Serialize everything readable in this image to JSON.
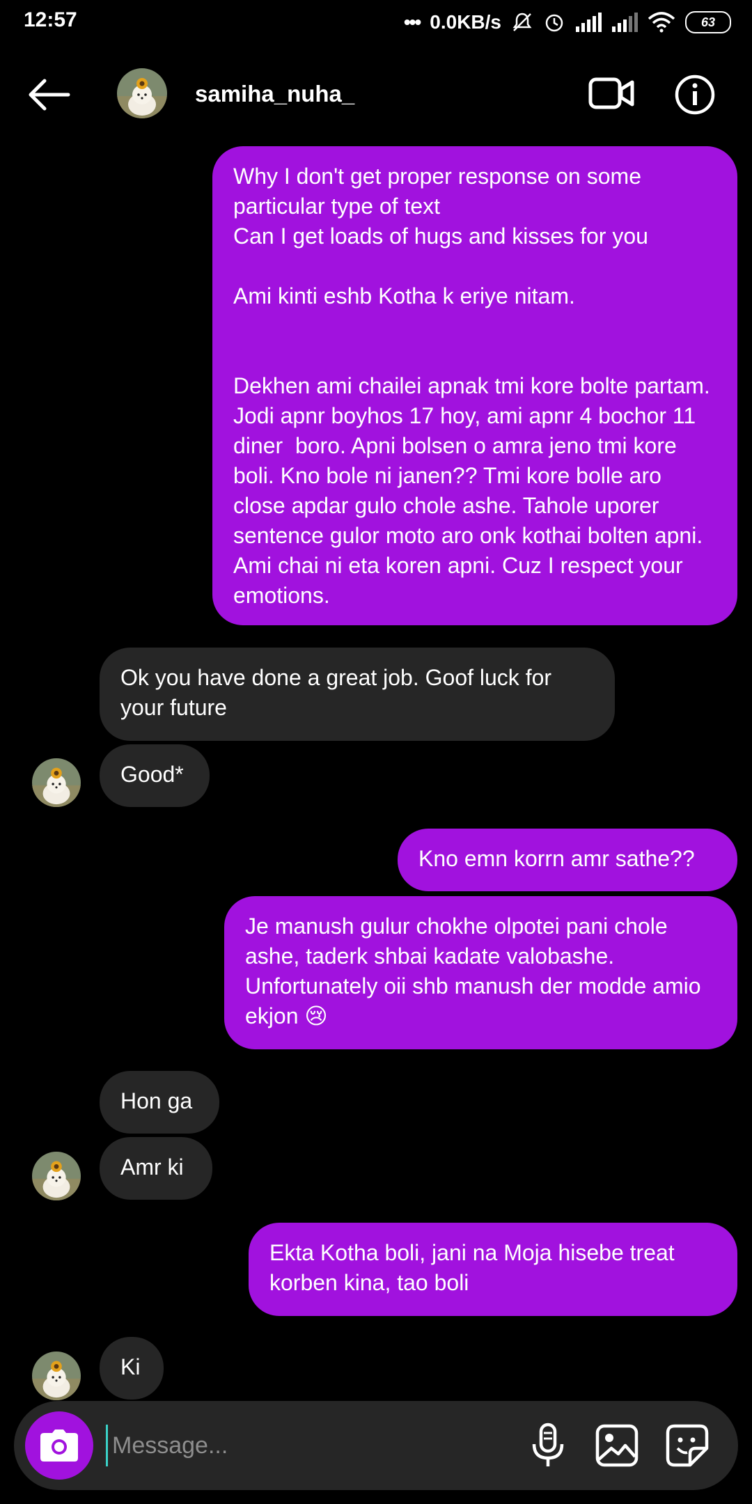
{
  "status_bar": {
    "time": "12:57",
    "net_speed": "0.0KB/s",
    "battery": "63"
  },
  "header": {
    "username": "samiha_nuha_"
  },
  "messages": [
    {
      "id": "m1",
      "type": "sent",
      "text": "Why I don't get proper response on some particular type of text\nCan I get loads of hugs and kisses for you\n\nAmi kinti eshb Kotha k eriye nitam.\n\n\nDekhen ami chailei apnak tmi kore bolte partam. Jodi apnr boyhos 17 hoy, ami apnr 4 bochor 11 diner  boro. Apni bolsen o amra jeno tmi kore boli. Kno bole ni janen?? Tmi kore bolle aro close apdar gulo chole ashe. Tahole uporer sentence gulor moto aro onk kothai bolten apni. Ami chai ni eta koren apni. Cuz I respect your emotions."
    },
    {
      "id": "m2",
      "type": "recv",
      "text": "Ok you have done a great job. Goof luck for your future"
    },
    {
      "id": "m3",
      "type": "recv",
      "text": "Good*"
    },
    {
      "id": "m4",
      "type": "sent",
      "text": "Kno emn korrn amr sathe??"
    },
    {
      "id": "m5",
      "type": "sent",
      "text": "Je manush gulur chokhe olpotei pani chole ashe, taderk shbai kadate valobashe. Unfortunately oii shb manush der modde amio ekjon 😢"
    },
    {
      "id": "m6",
      "type": "recv",
      "text": "Hon ga"
    },
    {
      "id": "m7",
      "type": "recv",
      "text": "Amr ki"
    },
    {
      "id": "m8",
      "type": "sent",
      "text": "Ekta Kotha boli, jani na Moja hisebe treat korben kina, tao boli"
    },
    {
      "id": "m9",
      "type": "recv",
      "text": "Ki"
    }
  ],
  "composer": {
    "placeholder": "Message..."
  },
  "colors": {
    "sent_bubble": "#a112de",
    "recv_bubble": "#262626",
    "background": "#000000"
  }
}
